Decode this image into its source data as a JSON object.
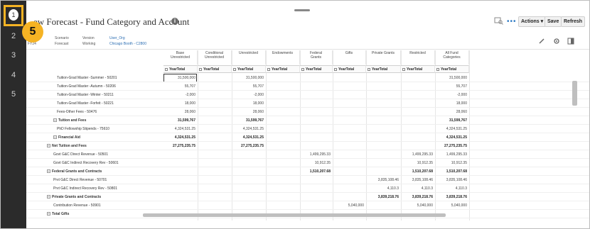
{
  "sidebar": {
    "step_active": "1",
    "numbers": [
      "2",
      "3",
      "4",
      "5"
    ]
  },
  "callout": {
    "number": "5"
  },
  "header": {
    "title": "New Forecast - Fund Category and Account",
    "title_partial": "ew Forecast - Fund Category and Account",
    "info_icon": "i",
    "dots": "•••",
    "actions_label": "Actions ▾",
    "save_label": "Save",
    "refresh_label": "Refresh"
  },
  "pov": {
    "year": "FY24",
    "scenario_label": "Scenario",
    "scenario_value": "Forecast",
    "version_label": "Version",
    "version_value": "Working",
    "user_label": "User_Org",
    "user_value": "Chicago Booth - C2800"
  },
  "grid": {
    "columns": [
      {
        "line1": "Base",
        "line2": "Unrestricted"
      },
      {
        "line1": "Conditional",
        "line2": "Unrestricted"
      },
      {
        "line1": "Unrestricted",
        "line2": ""
      },
      {
        "line1": "Endowments",
        "line2": ""
      },
      {
        "line1": "Federal",
        "line2": "Grants"
      },
      {
        "line1": "Gifts",
        "line2": ""
      },
      {
        "line1": "Private Grants",
        "line2": ""
      },
      {
        "line1": "Restricted",
        "line2": ""
      },
      {
        "line1": "All Fund",
        "line2": "Categories"
      }
    ],
    "yeartotal_label": "YearTotal",
    "rows": [
      {
        "label": "Tuition-Grad Master -Summer - 50201",
        "indent": 2,
        "bold": false,
        "vals": [
          "31,500,000",
          "",
          "31,500,000",
          "",
          "",
          "",
          "",
          "",
          "31,500,000"
        ]
      },
      {
        "label": "Tuition-Grad Master -Autumn - 50206",
        "indent": 2,
        "bold": false,
        "vals": [
          "55,707",
          "",
          "55,707",
          "",
          "",
          "",
          "",
          "",
          "55,707"
        ]
      },
      {
        "label": "Tuition-Grad Master -Winter - 50211",
        "indent": 2,
        "bold": false,
        "vals": [
          "-2,000",
          "",
          "-2,000",
          "",
          "",
          "",
          "",
          "",
          "-2,000"
        ]
      },
      {
        "label": "Tuition-Grad Master -Forfeit - 50221",
        "indent": 2,
        "bold": false,
        "vals": [
          "18,000",
          "",
          "18,000",
          "",
          "",
          "",
          "",
          "",
          "18,000"
        ]
      },
      {
        "label": "Fees-Other Fees - 50476",
        "indent": 2,
        "bold": false,
        "vals": [
          "28,060",
          "",
          "28,060",
          "",
          "",
          "",
          "",
          "",
          "28,060"
        ]
      },
      {
        "label": "Tuition and Fees",
        "indent": 1,
        "bold": true,
        "exp": true,
        "vals": [
          "31,599,767",
          "",
          "31,599,767",
          "",
          "",
          "",
          "",
          "",
          "31,599,767"
        ]
      },
      {
        "label": "PhD Fellowship Stipends - 75610",
        "indent": 2,
        "bold": false,
        "vals": [
          "4,324,531.25",
          "",
          "4,324,531.25",
          "",
          "",
          "",
          "",
          "",
          "4,324,531.25"
        ]
      },
      {
        "label": "Financial Aid",
        "indent": 1,
        "bold": true,
        "exp": true,
        "vals": [
          "4,324,531.25",
          "",
          "4,324,531.25",
          "",
          "",
          "",
          "",
          "",
          "4,324,531.25"
        ]
      },
      {
        "label": "Net Tuition and Fees",
        "indent": 0,
        "bold": true,
        "exp": true,
        "vals": [
          "27,275,235.75",
          "",
          "27,275,235.75",
          "",
          "",
          "",
          "",
          "",
          "27,275,235.75"
        ]
      },
      {
        "label": "Govt G&C Direct Revenue - 50501",
        "indent": 1,
        "bold": false,
        "vals": [
          "",
          "",
          "",
          "",
          "1,499,295.33",
          "",
          "",
          "1,499,295.33",
          "1,499,295.33"
        ]
      },
      {
        "label": "Govt G&C Indirect Recovery Rev - 50601",
        "indent": 1,
        "bold": false,
        "vals": [
          "",
          "",
          "",
          "",
          "10,912.35",
          "",
          "",
          "10,912.35",
          "10,912.35"
        ]
      },
      {
        "label": "Federal Grants and Contracts",
        "indent": 0,
        "bold": true,
        "exp": true,
        "vals": [
          "",
          "",
          "",
          "",
          "1,510,207.68",
          "",
          "",
          "1,510,207.68",
          "1,510,207.68"
        ]
      },
      {
        "label": "Prvt G&C Direct Revenue - 50701",
        "indent": 1,
        "bold": false,
        "vals": [
          "",
          "",
          "",
          "",
          "",
          "",
          "3,835,108.46",
          "3,835,108.46",
          "3,835,108.46"
        ]
      },
      {
        "label": "Prvt G&C Indirect Recovery Rev - 50801",
        "indent": 1,
        "bold": false,
        "vals": [
          "",
          "",
          "",
          "",
          "",
          "",
          "4,110.3",
          "4,110.3",
          "4,110.3"
        ]
      },
      {
        "label": "Private Grants and Contracts",
        "indent": 0,
        "bold": true,
        "exp": true,
        "vals": [
          "",
          "",
          "",
          "",
          "",
          "",
          "3,839,218.76",
          "3,839,218.76",
          "3,839,218.76"
        ]
      },
      {
        "label": "Contribution Revenue - 50901",
        "indent": 1,
        "bold": false,
        "vals": [
          "",
          "",
          "",
          "",
          "",
          "5,040,000",
          "",
          "5,040,000",
          "5,040,000"
        ]
      },
      {
        "label": "Total Gifts",
        "indent": 0,
        "bold": true,
        "exp": true,
        "vals": [
          "",
          "",
          "",
          "",
          "",
          "",
          "",
          "",
          ""
        ]
      }
    ]
  }
}
